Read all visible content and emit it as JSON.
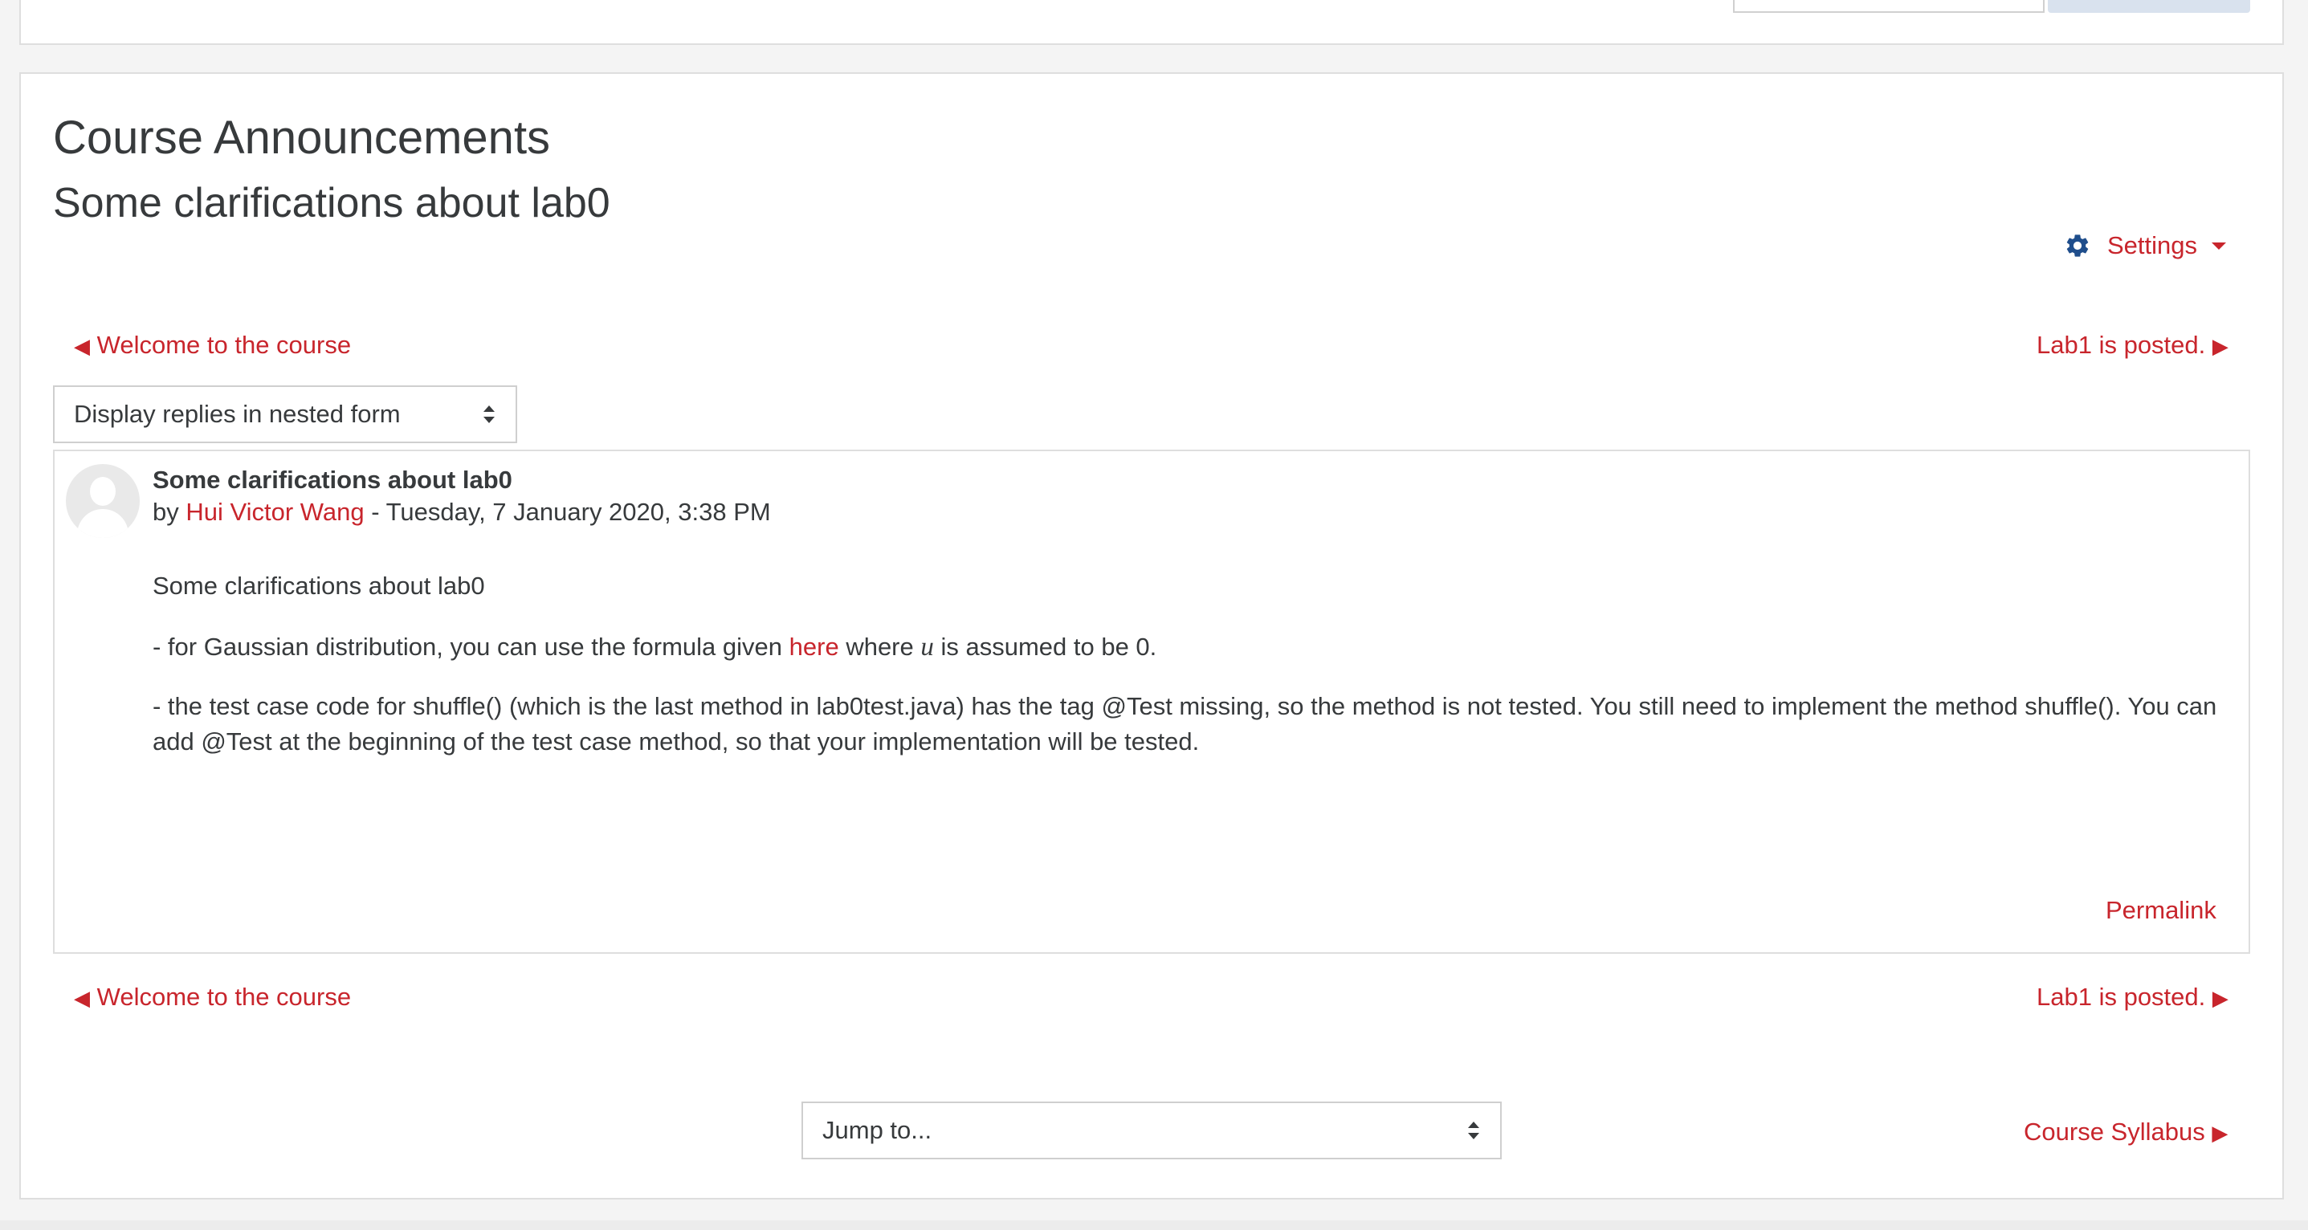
{
  "header": {
    "title": "Course Announcements",
    "discussion_title": "Some clarifications about lab0"
  },
  "settings": {
    "label": "Settings",
    "icon": "gear-icon"
  },
  "nav": {
    "prev_label": "Welcome to the course",
    "next_label": "Lab1 is posted.",
    "prev_icon": "◀",
    "next_icon": "▶"
  },
  "display_mode": {
    "selected": "Display replies in nested form"
  },
  "post": {
    "subject": "Some clarifications about lab0",
    "by": "by",
    "author": "Hui Victor Wang",
    "date": " - Tuesday, 7 January 2020, 3:38 PM",
    "para1": "Some clarifications about lab0",
    "para2_before": "- for Gaussian distribution, you can use the formula given ",
    "para2_link": "here",
    "para2_mid": " where ",
    "para2_var": "u",
    "para2_after": " is assumed to be 0.",
    "para3": "- the test case code for shuffle() (which is the last method in lab0test.java) has the tag @Test missing, so the method is not tested. You still need to implement the method shuffle(). You can add @Test at the beginning of the test case method, so that your implementation will be tested.",
    "permalink": "Permalink"
  },
  "footer": {
    "jump_to": "Jump to...",
    "next_activity": "Course Syllabus"
  },
  "colors": {
    "link": "#c8252c",
    "text": "#373a3c",
    "settings_icon": "#1f4e8c"
  }
}
